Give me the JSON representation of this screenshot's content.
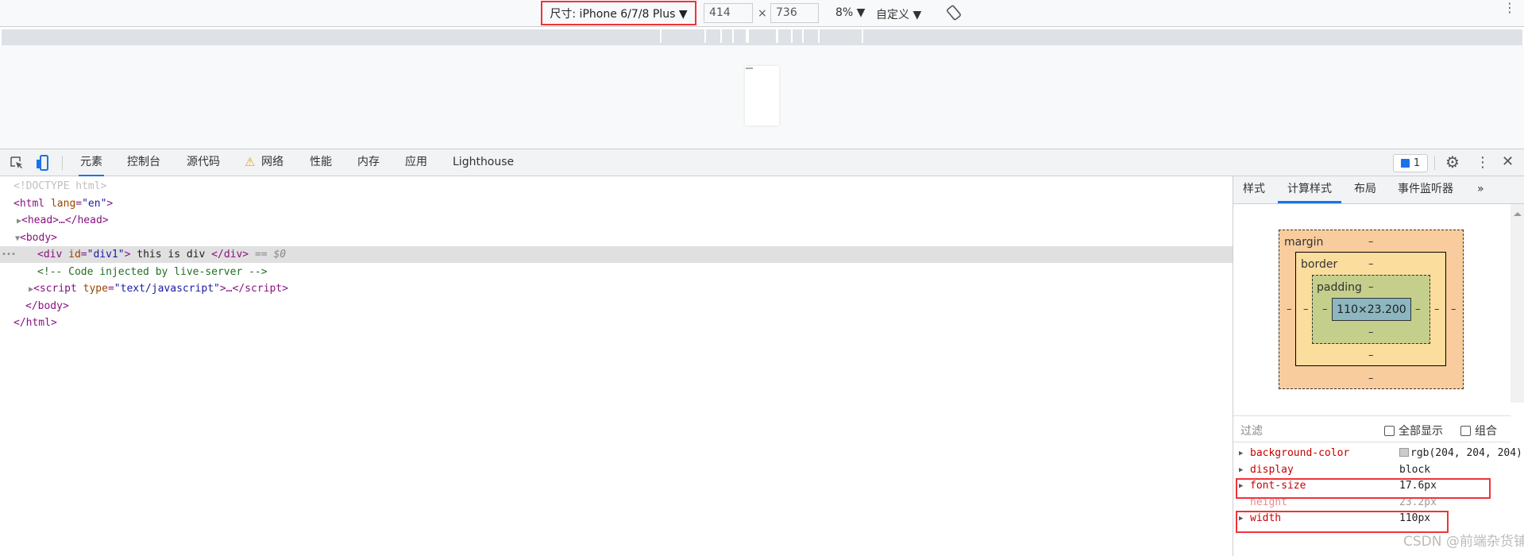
{
  "toolbar": {
    "device_label": "尺寸: iPhone 6/7/8 Plus ▼",
    "width": "414",
    "times": "×",
    "height": "736",
    "zoom": "8% ▼",
    "throttle": "自定义 ▼"
  },
  "devtools": {
    "tabs": [
      {
        "label": "元素"
      },
      {
        "label": "控制台"
      },
      {
        "label": "源代码"
      },
      {
        "label": "网络"
      },
      {
        "label": "性能"
      },
      {
        "label": "内存"
      },
      {
        "label": "应用"
      },
      {
        "label": "Lighthouse"
      }
    ],
    "issues_count": "1"
  },
  "dom": {
    "doctype": "<!DOCTYPE html>",
    "html_open": "<html",
    "html_attr": "lang",
    "html_val": "\"en\"",
    "head": "<head>…</head>",
    "body_open": "<body>",
    "div_open": "<div",
    "div_attr": "id",
    "div_val": "\"div1\"",
    "div_text": " this is div ",
    "div_close": "</div>",
    "div_ref": "== $0",
    "comment": "<!-- Code injected by live-server -->",
    "script_open": "<script",
    "script_attr": "type",
    "script_val": "\"text/javascript\"",
    "script_rest": ">…</script>",
    "body_close": "</body>",
    "html_close": "</html>",
    "ellipsis": "•••"
  },
  "sidebar": {
    "tabs": [
      {
        "label": "样式"
      },
      {
        "label": "计算样式"
      },
      {
        "label": "布局"
      },
      {
        "label": "事件监听器"
      },
      {
        "label": "»"
      }
    ],
    "box_model": {
      "margin": "margin",
      "border": "border",
      "padding": "padding",
      "content": "110×23.200",
      "dash": "–"
    },
    "filter_label": "过滤",
    "show_all": "全部显示",
    "group": "组合",
    "properties": [
      {
        "name": "background-color",
        "value": "rgb(204, 204, 204)",
        "swatch": "#cccccc"
      },
      {
        "name": "display",
        "value": "block"
      },
      {
        "name": "font-size",
        "value": "17.6px"
      },
      {
        "name": "height",
        "value": "23.2px"
      },
      {
        "name": "width",
        "value": "110px"
      }
    ]
  },
  "watermark": "CSDN @前端杂货铺"
}
